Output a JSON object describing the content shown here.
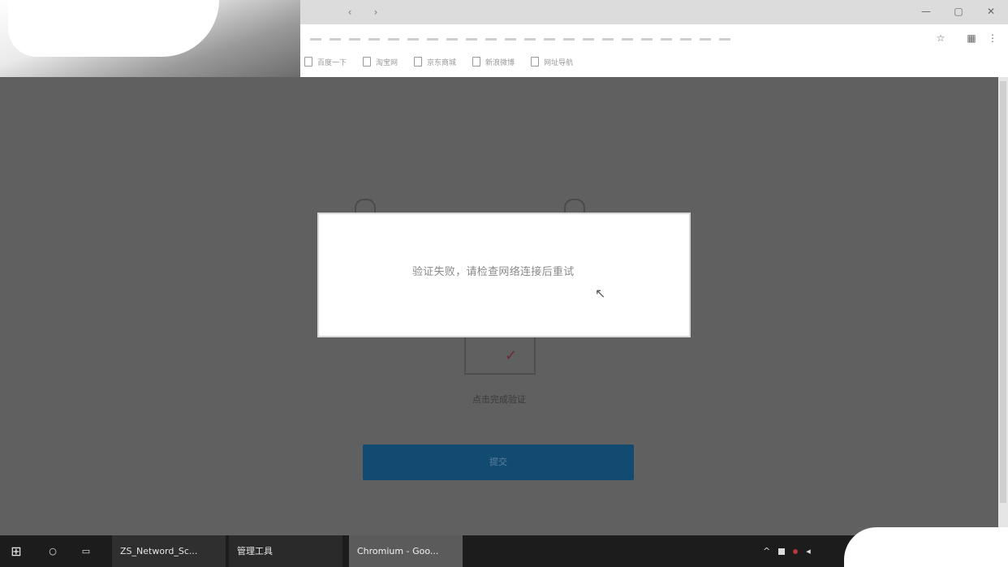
{
  "browser": {
    "nav": {
      "back_icon": "back-icon",
      "forward_icon": "forward-icon"
    },
    "window_controls": {
      "minimize": "—",
      "maximize": "▢",
      "close": "✕"
    },
    "bookmarks": [
      {
        "label": "百度一下"
      },
      {
        "label": "淘宝网"
      },
      {
        "label": "京东商城"
      },
      {
        "label": "新浪微博"
      },
      {
        "label": "网址导航"
      }
    ]
  },
  "page": {
    "captcha_label": "点击完成验证",
    "submit_label": "提交"
  },
  "modal": {
    "message": "验证失败，请检查网络连接后重试"
  },
  "taskbar": {
    "start_icon": "windows-start-icon",
    "apps": [
      {
        "label": "ZS_Netword_Sc..."
      },
      {
        "label": "管理工具"
      },
      {
        "label": "Chromium - Goo..."
      }
    ]
  }
}
